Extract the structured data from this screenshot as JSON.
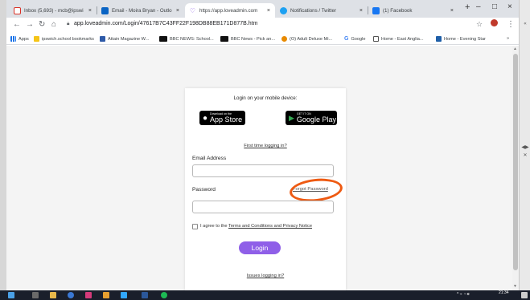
{
  "tabs": [
    {
      "title": "Inbox (5,693) - mcb@ipswi"
    },
    {
      "title": "Email - Moira Bryan - Outlo"
    },
    {
      "title": "https://app.loveadmin.com"
    },
    {
      "title": "Notifications / Twitter"
    },
    {
      "title": "(1) Facebook"
    }
  ],
  "new_tab": "+",
  "window": {
    "minimize": "–",
    "maximize": "□",
    "close": "×"
  },
  "address": {
    "url": "app.loveadmin.com/Login/47617B7C43FF22F198DB88EB171D877B.htm"
  },
  "bookmarks": [
    {
      "label": "Apps"
    },
    {
      "label": "ipswich.school bookmarks"
    },
    {
      "label": "Attain Magazine W..."
    },
    {
      "label": "BBC NEWS: School..."
    },
    {
      "label": "BBC News - Pick an..."
    },
    {
      "label": "(O) Adult Deluxe Mi..."
    },
    {
      "label": "Google"
    },
    {
      "label": "Home - East Anglia..."
    },
    {
      "label": "Home - Evening Star"
    }
  ],
  "bookmarks_more": "»",
  "login": {
    "heading": "Login on your mobile device:",
    "appstore_small": "Download on the",
    "appstore_big": "App Store",
    "googleplay_small": "GET IT ON",
    "googleplay_big": "Google Play",
    "first_time": "First time logging in?",
    "email_label": "Email Address",
    "email_value": "",
    "password_label": "Password",
    "password_value": "",
    "forgot": "Forgot Password",
    "agree_prefix": "I agree to the ",
    "agree_link": "Terms and Conditions and Privacy Notice",
    "login_button": "Login",
    "issues": "Issues logging in?"
  },
  "clock": {
    "time": "21:34"
  },
  "colors": {
    "accent": "#8f5fe8",
    "annotation": "#ee5a12"
  },
  "icons": {
    "back": "back-arrow-icon",
    "forward": "forward-arrow-icon",
    "reload": "reload-icon",
    "home": "home-icon",
    "star": "star-icon",
    "apple": "apple-icon",
    "play": "google-play-icon"
  }
}
